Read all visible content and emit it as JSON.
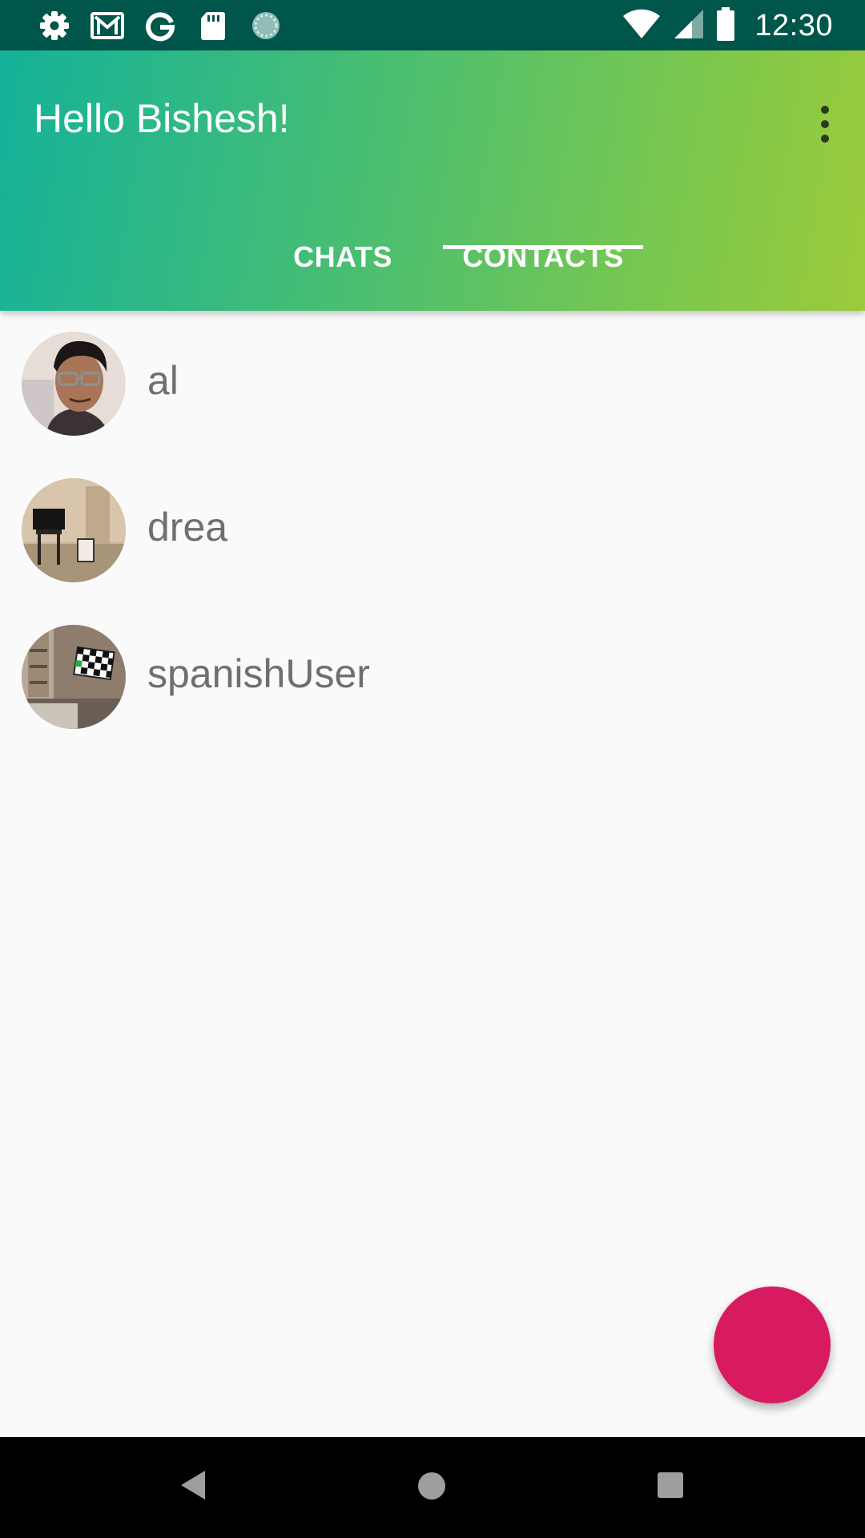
{
  "status_bar": {
    "time": "12:30",
    "left_icons": [
      "settings-icon",
      "gmail-icon",
      "google-icon",
      "sd-card-icon",
      "sync-icon"
    ],
    "right_icons": [
      "wifi-icon",
      "cell-signal-icon",
      "battery-icon"
    ]
  },
  "app_bar": {
    "title": "Hello Bishesh!",
    "menu_icon": "more-vert-icon",
    "gradient": [
      "#14b29a",
      "#9ccb3b"
    ]
  },
  "tabs": [
    {
      "label": "CHATS",
      "selected": false
    },
    {
      "label": "CONTACTS",
      "selected": true
    }
  ],
  "contacts": [
    {
      "name": "al",
      "avatar": "person-photo"
    },
    {
      "name": "drea",
      "avatar": "room-photo"
    },
    {
      "name": "spanishUser",
      "avatar": "room-tv-photo"
    }
  ],
  "fab": {
    "color": "#d81b60"
  },
  "nav_bar": {
    "icons": [
      "back-icon",
      "home-icon",
      "recents-icon"
    ]
  }
}
